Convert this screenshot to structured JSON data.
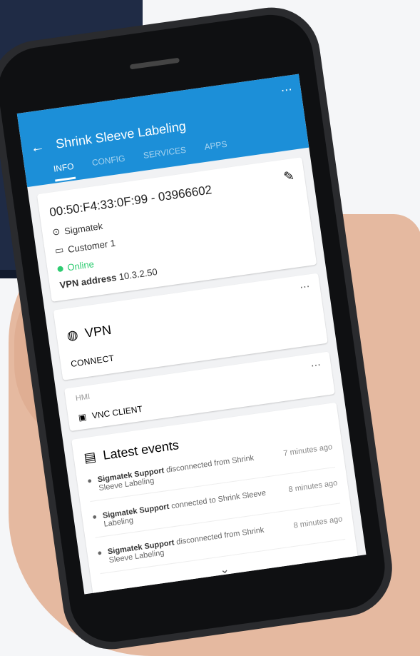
{
  "app": {
    "title": "Shrink Sleeve Labeling",
    "tabs": [
      "Info",
      "Config",
      "Services",
      "Apps"
    ],
    "active_tab": "Info"
  },
  "info_card": {
    "mac": "00:50:F4:33:0F:99 - 03966602",
    "company": "Sigmatek",
    "customer": "Customer 1",
    "status": "Online",
    "vpn_label": "VPN address",
    "vpn_value": "10.3.2.50"
  },
  "vpn_card": {
    "title": "VPN",
    "action": "CONNECT"
  },
  "hmi_card": {
    "label": "HMI",
    "item": "VNC CLIENT"
  },
  "events": {
    "title": "Latest events",
    "items": [
      {
        "actor": "Sigmatek Support",
        "text": "disconnected from Shrink Sleeve Labeling",
        "time": "7 minutes ago"
      },
      {
        "actor": "Sigmatek Support",
        "text": "connected to Shrink Sleeve Labeling",
        "time": "8 minutes ago"
      },
      {
        "actor": "Sigmatek Support",
        "text": "disconnected from Shrink Sleeve Labeling",
        "time": "8 minutes ago"
      }
    ]
  },
  "colors": {
    "accent": "#1c8fd8",
    "online": "#2ecc71"
  },
  "icons": {
    "back": "arrow-left-icon",
    "menu": "more-vert-icon",
    "edit": "pencil-icon",
    "company": "building-icon",
    "customer": "tag-icon",
    "vpn": "globe-icon",
    "vnc": "cast-icon",
    "events": "list-icon",
    "person": "person-icon",
    "chevron": "chevron-down-icon"
  }
}
